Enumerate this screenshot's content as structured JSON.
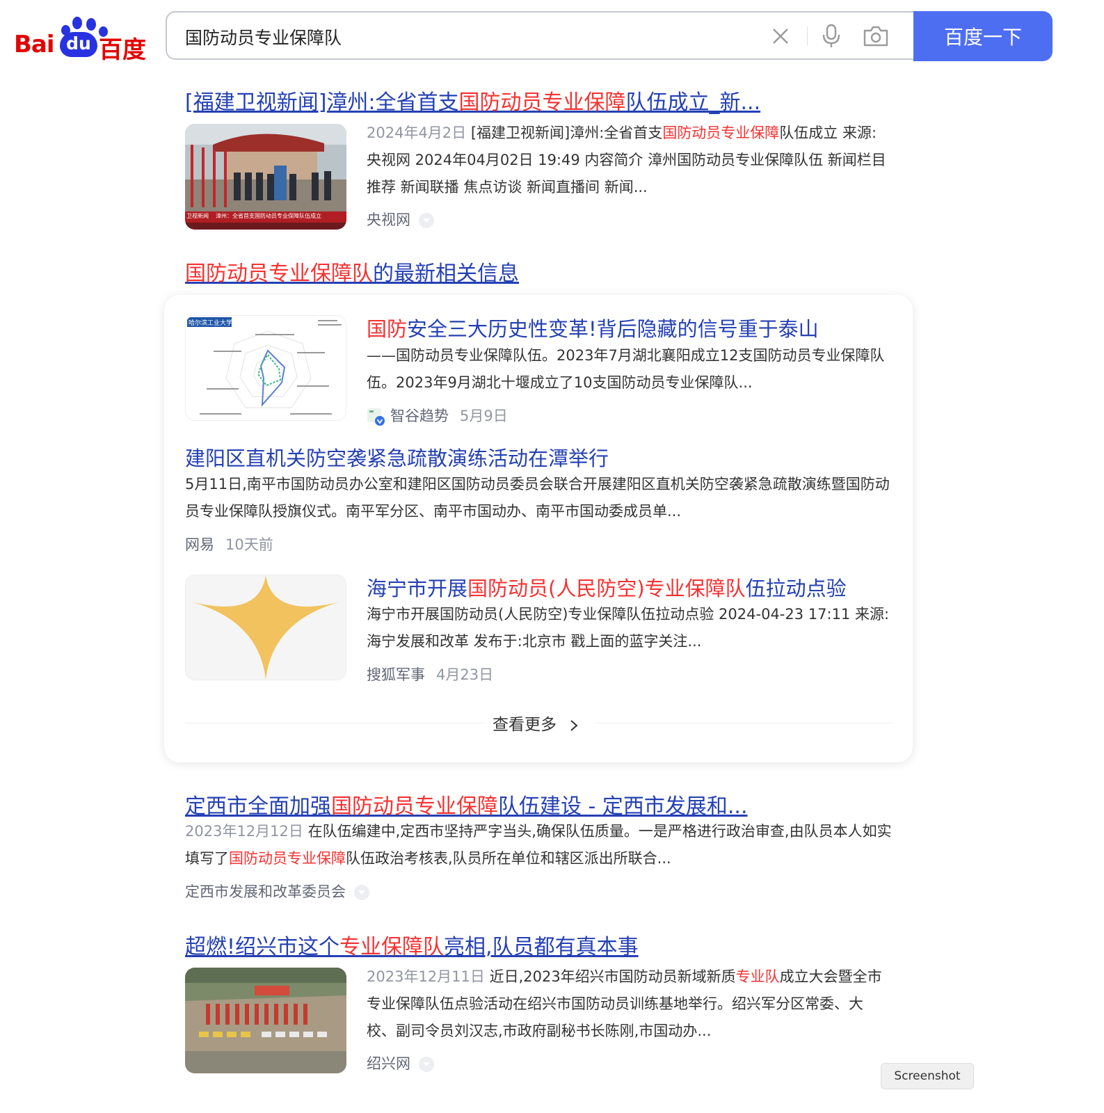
{
  "logo": {
    "bai": "Bai",
    "du": "du",
    "cn": "百度"
  },
  "search": {
    "query": "国防动员专业保障队",
    "button": "百度一下"
  },
  "results": [
    {
      "title_pre": "[福建卫视新闻]漳州:全省首支",
      "title_hl": "国防动员专业保障",
      "title_post": "队伍成立_新...",
      "date": "2024年4月2日",
      "snippet_pre": " [福建卫视新闻]漳州:全省首支",
      "snippet_hl": "国防动员专业保障",
      "snippet_post": "队伍成立 来源: 央视网 2024年04月02日 19:49 内容简介 漳州国防动员专业保障队伍 新闻栏目推荐 新闻联播 焦点访谈 新闻直播间 新闻...",
      "source": "央视网",
      "thumb_caption": "漳州：全省首支国防动员专业保障队伍成立",
      "thumb_tag": "卫视新闻"
    },
    {
      "title_pre": "定西市全面加强",
      "title_hl": "国防动员专业保障",
      "title_post": "队伍建设 - 定西市发展和...",
      "date": "2023年12月12日",
      "snippet_pre": " 在队伍编建中,定西市坚持严字当头,确保队伍质量。一是严格进行政治审查,由队员本人如实填写了",
      "snippet_hl": "国防动员专业保障",
      "snippet_post": "队伍政治考核表,队员所在单位和辖区派出所联合...",
      "source": "定西市发展和改革委员会"
    },
    {
      "title_pre": "超燃!绍兴市这个",
      "title_hl": "专业保障队",
      "title_post": "亮相,队员都有真本事",
      "date": "2023年12月11日",
      "snippet_pre": " 近日,2023年绍兴市国防动员新域新质",
      "snippet_hl": "专业队",
      "snippet_post": "成立大会暨全市专业保障队伍点验活动在绍兴市国防动员训练基地举行。绍兴军分区常委、大校、副司令员刘汉志,市政府副秘书长陈刚,市国动办...",
      "source": "绍兴网"
    }
  ],
  "news": {
    "heading_hl": "国防动员专业保障队",
    "heading_post": "的最新相关信息",
    "items": [
      {
        "title_hl": "国防",
        "title_post": "安全三大历史性变革!背后隐藏的信号重于泰山",
        "snippet": "——国防动员专业保障队伍。2023年7月湖北襄阳成立12支国防动员专业保障队伍。2023年9月湖北十堰成立了10支国防动员专业保障队...",
        "source": "智谷趋势",
        "time": "5月9日",
        "thumb_label": "哈尔滨工业大学"
      },
      {
        "title": "建阳区直机关防空袭紧急疏散演练活动在潭举行",
        "snippet": "5月11日,南平市国防动员办公室和建阳区国防动员委员会联合开展建阳区直机关防空袭紧急疏散演练暨国防动员专业保障队授旗仪式。南平军分区、南平市国动办、南平市国动委成员单...",
        "source": "网易",
        "time": "10天前"
      },
      {
        "title_pre": "海宁市开展",
        "title_hl": "国防动员(人民防空)专业保障队",
        "title_post": "伍拉动点验",
        "snippet": "海宁市开展国防动员(人民防空)专业保障队伍拉动点验 2024-04-23 17:11 来源: 海宁发展和改革 发布于:北京市 戳上面的蓝字关注...",
        "source": "搜狐军事",
        "time": "4月23日"
      }
    ],
    "see_more": "查看更多"
  },
  "screenshot_tip": "Screenshot"
}
